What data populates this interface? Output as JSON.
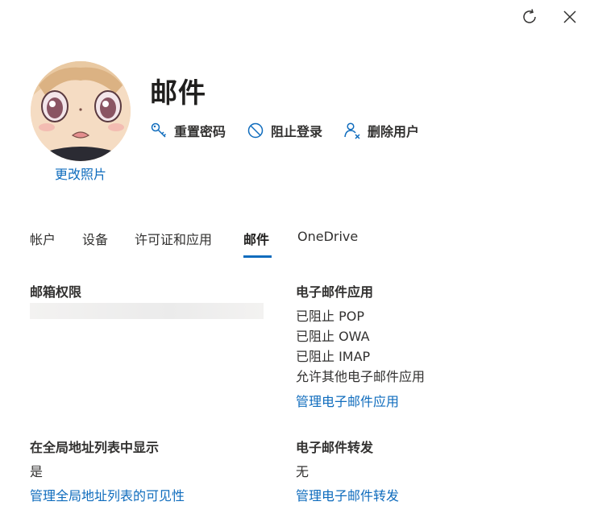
{
  "window": {
    "refresh_icon": "refresh-icon",
    "close_icon": "close-icon"
  },
  "user": {
    "name": "邮件",
    "change_photo": "更改照片"
  },
  "actions": [
    {
      "label": "重置密码",
      "icon": "key-icon"
    },
    {
      "label": "阻止登录",
      "icon": "block-icon"
    },
    {
      "label": "删除用户",
      "icon": "delete-user-icon"
    }
  ],
  "tabs": [
    {
      "label": "帐户",
      "active": false
    },
    {
      "label": "设备",
      "active": false
    },
    {
      "label": "许可证和应用",
      "active": false
    },
    {
      "label": "邮件",
      "active": true
    },
    {
      "label": "OneDrive",
      "active": false
    }
  ],
  "mailbox_permissions": {
    "title": "邮箱权限"
  },
  "email_apps": {
    "title": "电子邮件应用",
    "lines": [
      "已阻止 POP",
      "已阻止 OWA",
      "已阻止 IMAP",
      "允许其他电子邮件应用"
    ],
    "link": "管理电子邮件应用"
  },
  "global_address_list": {
    "title": "在全局地址列表中显示",
    "value": "是",
    "link": "管理全局地址列表的可见性"
  },
  "email_forwarding": {
    "title": "电子邮件转发",
    "value": "无",
    "link": "管理电子邮件转发"
  },
  "colors": {
    "accent": "#0f6cbd",
    "text": "#323130"
  }
}
